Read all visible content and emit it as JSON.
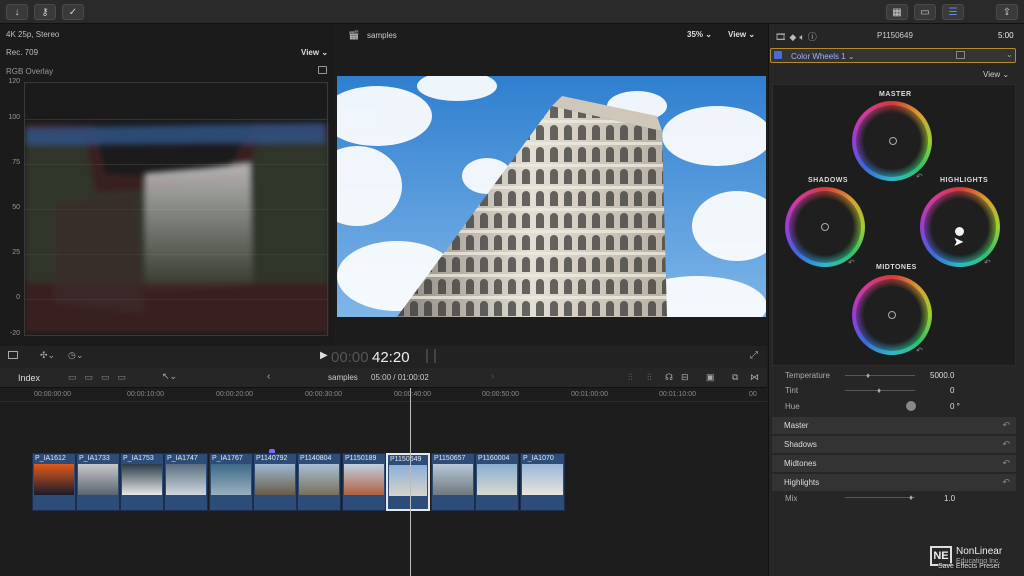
{
  "toolbar": {
    "icons": [
      "import-icon",
      "keyword-icon",
      "background-tasks-icon",
      "browser-layout-icon",
      "timeline-layout-icon",
      "inspector-layout-icon",
      "share-icon"
    ]
  },
  "scopes": {
    "format": "4K 25p, Stereo",
    "colorspace": "Rec. 709",
    "view_label": "View",
    "overlay": "RGB Overlay",
    "y_labels": [
      "120",
      "100",
      "75",
      "50",
      "25",
      "0",
      "-20"
    ]
  },
  "viewer": {
    "title": "samples",
    "zoom": "35%",
    "view_label": "View",
    "timecode_dim": "00:00",
    "timecode": "42:20"
  },
  "timeline": {
    "index_label": "Index",
    "project": "samples",
    "position": "05:00 / 01:00:02",
    "ruler": [
      "00:00:00:00",
      "00:00:10:00",
      "00:00:20:00",
      "00:00:30:00",
      "00:00:40:00",
      "00:00:50:00",
      "00:01:00:00",
      "00:01:10:00",
      "00"
    ],
    "clips": [
      {
        "name": "P_IA1612",
        "colors": [
          "#e05a1a",
          "#1b1b2a"
        ]
      },
      {
        "name": "P_IA1733",
        "colors": [
          "#c8c8c8",
          "#5a6470"
        ]
      },
      {
        "name": "P_IA1753",
        "colors": [
          "#2a3a48",
          "#e8e8e8"
        ]
      },
      {
        "name": "P_IA1747",
        "colors": [
          "#5a6e80",
          "#d0d8e0"
        ]
      },
      {
        "name": "P_IA1767",
        "colors": [
          "#3e6a8a",
          "#9ab0c0"
        ]
      },
      {
        "name": "P1140792",
        "colors": [
          "#9cb8d0",
          "#6a5c48"
        ]
      },
      {
        "name": "P1140804",
        "colors": [
          "#a8c0d4",
          "#7a705a"
        ]
      },
      {
        "name": "P1150189",
        "colors": [
          "#c0d0e0",
          "#b06040"
        ]
      },
      {
        "name": "P1150649",
        "colors": [
          "#8ab0d8",
          "#d8d4c8"
        ]
      },
      {
        "name": "P1150657",
        "colors": [
          "#b8c8d8",
          "#707880"
        ]
      },
      {
        "name": "P1160004",
        "colors": [
          "#8ab0d0",
          "#d8d8d0"
        ]
      },
      {
        "name": "P_IA1070",
        "colors": [
          "#9ab8d8",
          "#e8e4dc"
        ]
      }
    ]
  },
  "inspector": {
    "clip_name": "P1150649",
    "duration": "5:00",
    "effect": "Color Wheels 1",
    "view_label": "View",
    "wheels": {
      "master": "MASTER",
      "shadows": "SHADOWS",
      "highlights": "HIGHLIGHTS",
      "midtones": "MIDTONES"
    },
    "params": [
      {
        "label": "Temperature",
        "value": "5000.0"
      },
      {
        "label": "Tint",
        "value": "0"
      },
      {
        "label": "Hue",
        "value": "0 °"
      }
    ],
    "sections": [
      "Master",
      "Shadows",
      "Midtones",
      "Highlights"
    ],
    "mix": {
      "label": "Mix",
      "value": "1.0"
    },
    "save_preset": "Save Effects Preset"
  },
  "watermark": {
    "brand": "NonLinear",
    "sub": "Educating Inc."
  }
}
